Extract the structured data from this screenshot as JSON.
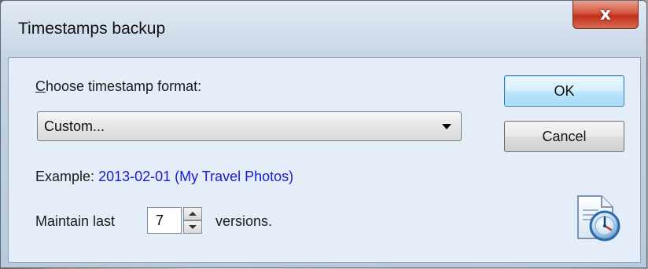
{
  "window": {
    "title": "Timestamps backup",
    "close_glyph": "x"
  },
  "format": {
    "label": "Choose timestamp format:",
    "selected": "Custom..."
  },
  "example": {
    "label": "Example:",
    "value": "2013-02-01 (My Travel Photos)"
  },
  "versions": {
    "prefix": "Maintain last",
    "value": "7",
    "suffix": "versions."
  },
  "buttons": {
    "ok": "OK",
    "cancel": "Cancel"
  },
  "icons": {
    "dialog": "document-clock-icon"
  },
  "colors": {
    "link_blue": "#1a1ad0",
    "close_red": "#c0301c"
  }
}
